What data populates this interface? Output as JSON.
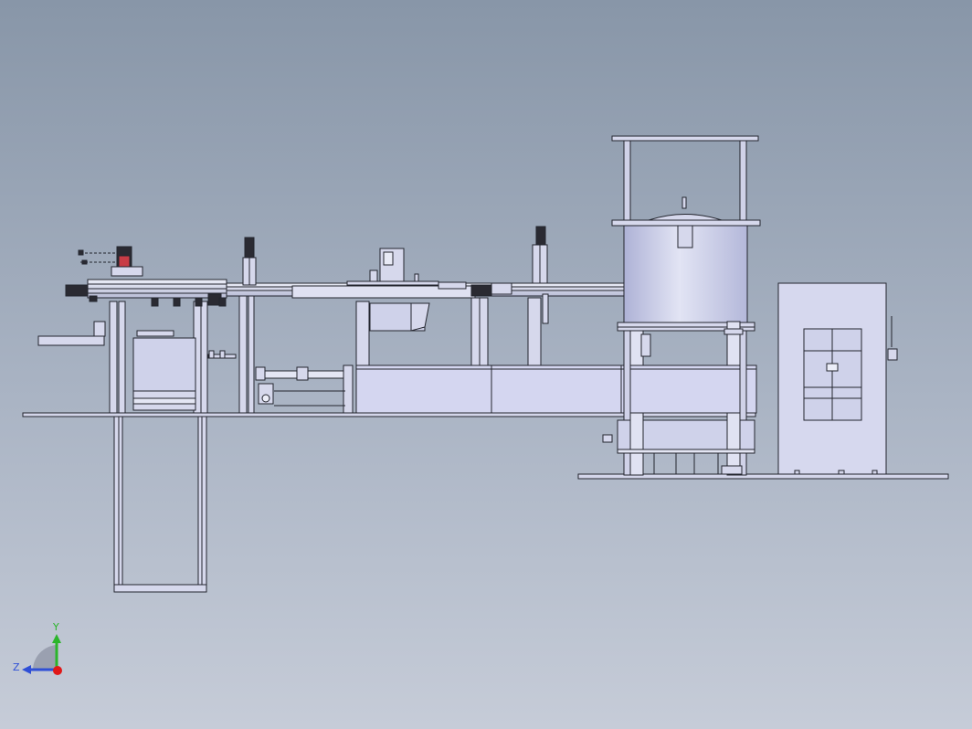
{
  "viewport": {
    "view_mode": "shaded-with-edges",
    "colors": {
      "background_top": "#8896a8",
      "background_bottom": "#c6ccd8",
      "part_fill": "#d6d8ec",
      "part_fill_dark": "#c2c6e0",
      "edge": "#23252e",
      "accent_red": "#c83c46",
      "dark_part": "#2a2a32"
    }
  },
  "triad": {
    "y_label": "Y",
    "z_label": "Z",
    "y_color": "#2bb52b",
    "z_color": "#2f4fd6",
    "x_color": "#e01818"
  }
}
